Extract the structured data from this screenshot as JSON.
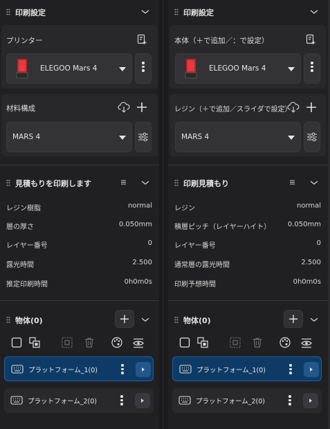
{
  "left": {
    "header": {
      "title": "印刷設定"
    },
    "printer": {
      "label": "プリンター",
      "selected": "ELEGOO Mars 4"
    },
    "material": {
      "label": "材料構成",
      "selected": "MARS 4"
    },
    "estimate": {
      "title": "見積もりを印刷します",
      "rows": [
        {
          "k": "レジン樹脂",
          "v": "normal"
        },
        {
          "k": "層の厚さ",
          "v": "0.050mm"
        },
        {
          "k": "レイヤー番号",
          "v": "0"
        },
        {
          "k": "露光時間",
          "v": "2.500"
        },
        {
          "k": "推定印刷時間",
          "v": "0h0m0s"
        }
      ]
    },
    "objects": {
      "title": "物体(0)",
      "items": [
        "プラットフォーム_1(0)",
        "プラットフォーム_2(0)"
      ]
    }
  },
  "right": {
    "header": {
      "title": "印刷設定"
    },
    "printer": {
      "label": "本体（＋で追加／：で設定）",
      "selected": "ELEGOO Mars 4"
    },
    "material": {
      "label": "レジン（＋で追加／スライダで設定）",
      "selected": "MARS 4"
    },
    "estimate": {
      "title": "印刷見積もり",
      "rows": [
        {
          "k": "レジン",
          "v": "normal"
        },
        {
          "k": "積層ピッチ（レイヤーハイト）",
          "v": "0.050mm"
        },
        {
          "k": "レイヤー番号",
          "v": "0"
        },
        {
          "k": "通常層の露光時間",
          "v": "2.500"
        },
        {
          "k": "印刷予想時間",
          "v": "0h0m0s"
        }
      ]
    },
    "objects": {
      "title": "物体(0)",
      "items": [
        "プラットフォーム_1(0)",
        "プラットフォーム_2(0)"
      ]
    }
  },
  "colors": {
    "accent": "#0e3b66",
    "accent_border": "#1d5fa2",
    "printer_red": "#c0232b"
  }
}
